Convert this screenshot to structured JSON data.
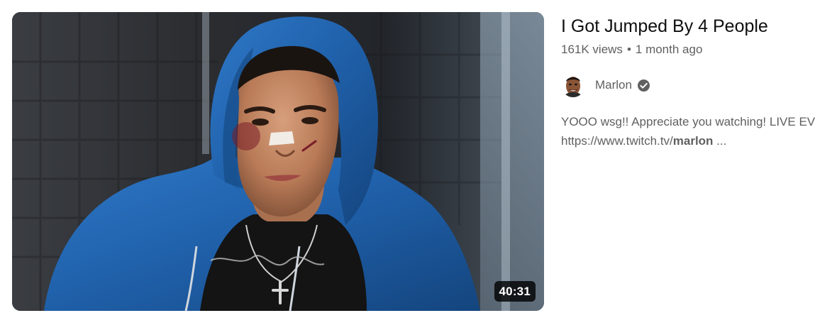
{
  "video": {
    "title": "I Got Jumped By 4 People",
    "views": "161K views",
    "separator": "•",
    "age": "1 month ago",
    "duration": "40:31",
    "thumbnail_icon": "hooded-person-thumbnail"
  },
  "channel": {
    "name": "Marlon",
    "verified_icon": "verified-check-icon",
    "avatar_icon": "channel-avatar"
  },
  "description": {
    "line1": "YOOO wsg!! Appreciate you watching! LIVE EV",
    "line2_prefix": "https://www.twitch.tv/",
    "line2_bold": "marlon",
    "line2_suffix": " ..."
  },
  "colors": {
    "text_primary": "#0f0f0f",
    "text_secondary": "#606060",
    "badge_bg": "#000000cc",
    "hoodie_blue": "#1f5fa8"
  }
}
